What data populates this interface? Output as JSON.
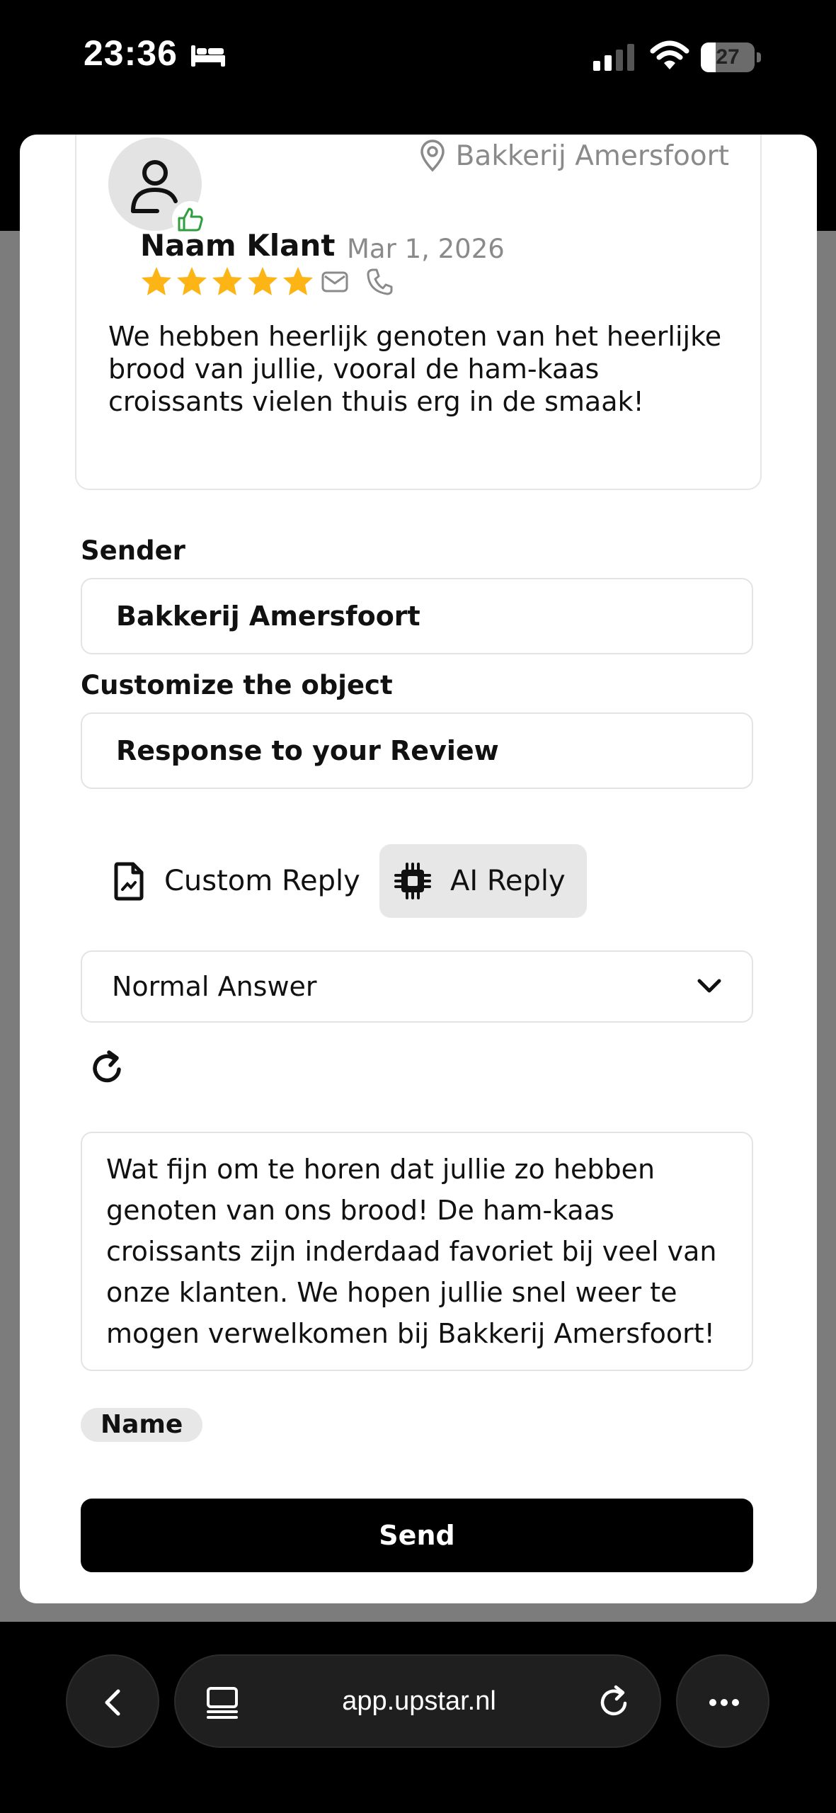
{
  "status_bar": {
    "time": "23:36",
    "battery": "27",
    "battery_level": 0.27,
    "icons": [
      "bed-icon",
      "cellular-signal-icon",
      "wifi-icon",
      "battery-icon"
    ]
  },
  "review": {
    "location": "Bakkerij Amersfoort",
    "reviewer_name": "Naam Klant",
    "date": "Mar 1, 2026",
    "rating": 5,
    "rating_max": 5,
    "text": "We hebben heerlijk genoten van het heerlijke brood van jullie, vooral de ham-kaas croissants vielen thuis erg in de smaak!",
    "icons": [
      "person-icon",
      "thumbs-up-icon",
      "location-pin-icon",
      "star-icon",
      "mail-icon",
      "phone-icon"
    ]
  },
  "form": {
    "sender_label": "Sender",
    "sender_value": "Bakkerij Amersfoort",
    "object_label": "Customize the object",
    "object_value": "Response to your Review",
    "tabs": [
      {
        "label": "Custom Reply",
        "icon": "document-icon",
        "active": false
      },
      {
        "label": "AI Reply",
        "icon": "chip-icon",
        "active": true
      }
    ],
    "answer_type": "Normal Answer",
    "reply_text": "Wat fijn om te horen dat jullie zo hebben genoten van ons brood! De ham-kaas croissants zijn inderdaad favoriet bij veel van onze klanten. We hopen jullie snel weer te mogen verwelkomen bij Bakkerij Amersfoort!",
    "name_chip": "Name",
    "send_label": "Send"
  },
  "browser": {
    "url": "app.upstar.nl",
    "icons": [
      "back-icon",
      "tabs-icon",
      "reload-icon",
      "more-icon"
    ]
  },
  "colors": {
    "star": "#FDB515",
    "thumb": "#2E9E3E",
    "muted_text": "#8A8A8A",
    "active_tab": "#E7E7E7",
    "primary_button": "#000000"
  }
}
